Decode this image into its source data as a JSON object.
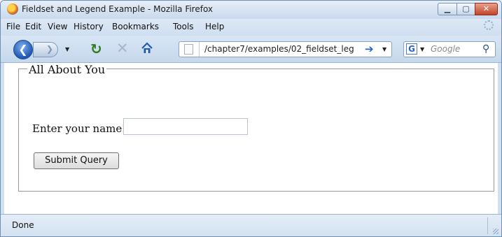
{
  "window": {
    "title": "Fieldset and Legend Example - Mozilla Firefox"
  },
  "menubar": {
    "items": [
      "File",
      "Edit",
      "View",
      "History",
      "Bookmarks",
      "Tools",
      "Help"
    ]
  },
  "navbar": {
    "url": "/chapter7/examples/02_fieldset_leg",
    "search_placeholder": "Google",
    "search_engine_icon": "G"
  },
  "page": {
    "legend": "All About You",
    "name_label": "Enter your name:",
    "name_value": "",
    "submit_label": "Submit Query"
  },
  "statusbar": {
    "text": "Done"
  },
  "icons": {
    "back": "back-arrow-icon",
    "forward": "forward-arrow-icon",
    "reload": "reload-icon",
    "stop": "stop-icon",
    "home": "home-icon",
    "go": "go-arrow-icon",
    "search": "magnifier-icon"
  }
}
